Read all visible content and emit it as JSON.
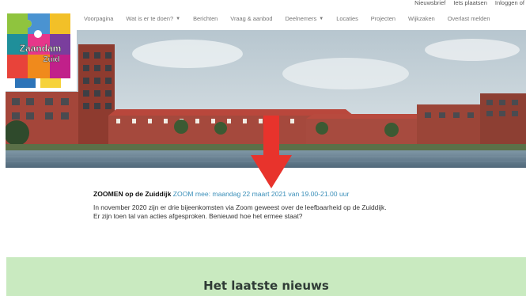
{
  "top_links": [
    "Nieuwsbrief",
    "Iets plaatsen",
    "Inloggen of"
  ],
  "nav": [
    {
      "label": "Voorpagina",
      "dropdown": false
    },
    {
      "label": "Wat is er te doen?",
      "dropdown": true
    },
    {
      "label": "Berichten",
      "dropdown": false
    },
    {
      "label": "Vraag & aanbod",
      "dropdown": false
    },
    {
      "label": "Deelnemers",
      "dropdown": true
    },
    {
      "label": "Locaties",
      "dropdown": false
    },
    {
      "label": "Projecten",
      "dropdown": false
    },
    {
      "label": "Wijkzaken",
      "dropdown": false
    },
    {
      "label": "Overlast melden",
      "dropdown": false
    }
  ],
  "logo": {
    "line1": "Zaandam",
    "line2": "Zuid"
  },
  "article": {
    "title_bold": "ZOOMEN op de Zuiddijk",
    "title_link": "ZOOM mee: maandag 22 maart 2021 van 19.00-21.00 uur",
    "body_lines": [
      "In november 2020 zijn er drie bijeenkomsten via Zoom geweest over de leefbaarheid op de Zuiddijk.",
      "Er zijn toen tal van acties afgesproken. Benieuwd hoe het ermee staat?"
    ]
  },
  "news": {
    "heading": "Het laatste nieuws"
  },
  "colors": {
    "link": "#3a8fb9",
    "news_bg": "#c9eac0",
    "arrow": "#e8332c"
  }
}
